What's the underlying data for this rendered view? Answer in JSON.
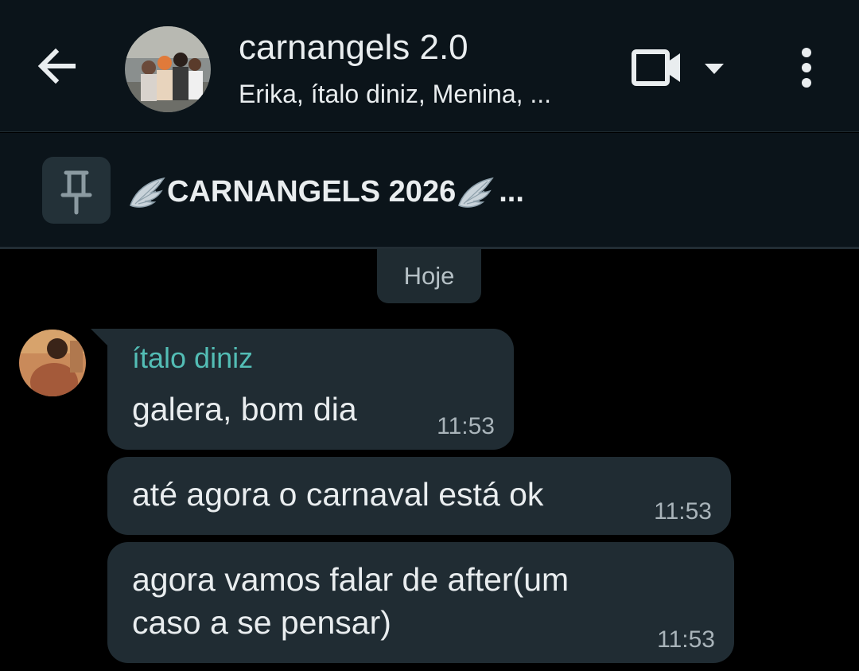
{
  "header": {
    "back_icon": "arrow-left-icon",
    "group_name": "carnangels 2.0",
    "members": "Erika, ítalo diniz, Menina, ...",
    "video_icon": "video-camera-icon",
    "caret_icon": "caret-down-icon",
    "more_icon": "more-vertical-icon"
  },
  "pinned": {
    "icon": "pin-icon",
    "wing_icon": "angel-wing-icon",
    "text": "CARNANGELS 2026",
    "ellipsis": "..."
  },
  "chat": {
    "date_label": "Hoje",
    "messages": [
      {
        "sender": "ítalo diniz",
        "text": "galera, bom dia",
        "time": "11:53"
      },
      {
        "text": "até agora o carnaval está ok",
        "time": "11:53"
      },
      {
        "text_line1": "agora vamos falar de after(um",
        "text_line2": "caso a se pensar)",
        "time": "11:53"
      }
    ]
  },
  "colors": {
    "header_bg": "#0b141a",
    "bubble_bg": "#202c33",
    "sender_name": "#53bdb5",
    "timestamp": "#a9b4ba"
  }
}
